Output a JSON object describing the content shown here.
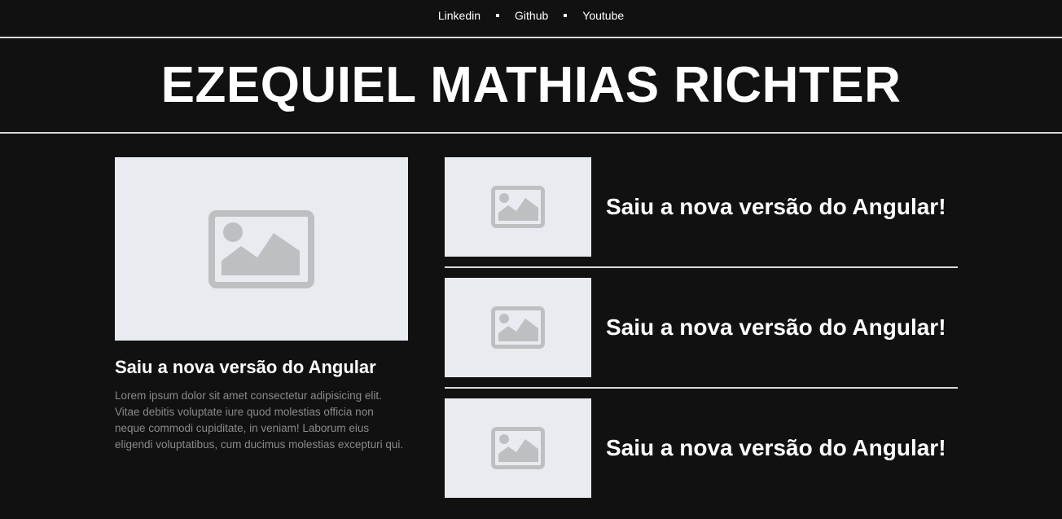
{
  "nav": {
    "links": [
      "Linkedin",
      "Github",
      "Youtube"
    ]
  },
  "header": {
    "title": "EZEQUIEL MATHIAS RICHTER"
  },
  "featured": {
    "image_icon": "image-placeholder-icon",
    "title": "Saiu a nova versão do Angular",
    "body": "Lorem ipsum dolor sit amet consectetur adipisicing elit. Vitae debitis voluptate iure quod molestias officia non neque commodi cupiditate, in veniam! Laborum eius eligendi voluptatibus, cum ducimus molestias excepturi qui."
  },
  "list": {
    "items": [
      {
        "title": "Saiu a nova versão do Angular!",
        "image_icon": "image-placeholder-icon"
      },
      {
        "title": "Saiu a nova versão do Angular!",
        "image_icon": "image-placeholder-icon"
      },
      {
        "title": "Saiu a nova versão do Angular!",
        "image_icon": "image-placeholder-icon"
      }
    ]
  },
  "colors": {
    "background": "#111111",
    "text": "#ffffff",
    "muted_text": "#8a8a8a",
    "placeholder_bg": "#e8ecf0",
    "placeholder_icon": "#bdbfc1",
    "rule": "#d9d9d9"
  }
}
